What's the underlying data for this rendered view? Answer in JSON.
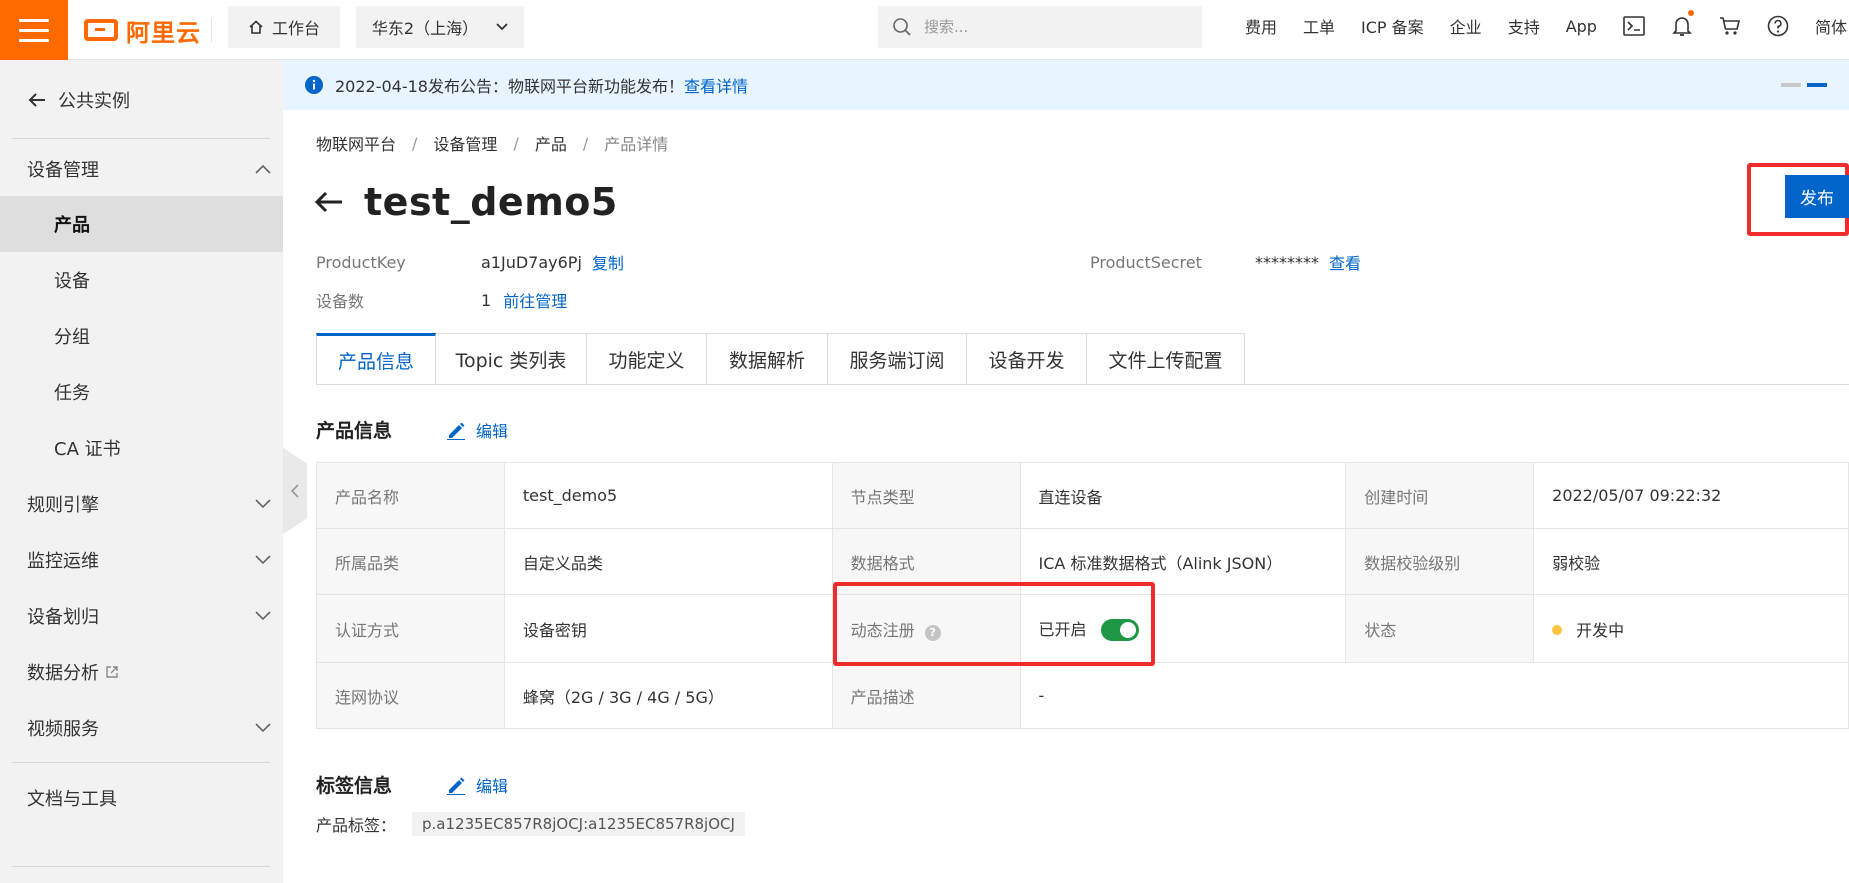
{
  "topbar": {
    "logo_text": "阿里云",
    "workbench_label": "工作台",
    "region_label": "华东2（上海）",
    "search_placeholder": "搜索...",
    "nav": [
      "费用",
      "工单",
      "ICP 备案",
      "企业",
      "支持",
      "App"
    ],
    "icons": [
      "terminal-icon",
      "bell-icon",
      "cart-icon",
      "help-icon"
    ],
    "lang_label": "简体"
  },
  "sidebar": {
    "back_label": "公共实例",
    "device_mgmt": {
      "label": "设备管理",
      "items": [
        "产品",
        "设备",
        "分组",
        "任务",
        "CA 证书"
      ],
      "active": "产品"
    },
    "groups": [
      "规则引擎",
      "监控运维",
      "设备划归",
      "数据分析",
      "视频服务"
    ],
    "docs_label": "文档与工具"
  },
  "notice": {
    "text": "2022-04-18发布公告：物联网平台新功能发布！",
    "link": "查看详情"
  },
  "breadcrumb": [
    "物联网平台",
    "设备管理",
    "产品",
    "产品详情"
  ],
  "page": {
    "title": "test_demo5",
    "publish_label": "发布"
  },
  "meta": {
    "product_key_label": "ProductKey",
    "product_key_value": "a1JuD7ay6Pj",
    "copy_label": "复制",
    "product_secret_label": "ProductSecret",
    "product_secret_value": "********",
    "view_label": "查看",
    "device_count_label": "设备数",
    "device_count_value": "1",
    "manage_label": "前往管理"
  },
  "tabs": [
    {
      "label": "产品信息",
      "active": true
    },
    {
      "label": "Topic 类列表"
    },
    {
      "label": "功能定义"
    },
    {
      "label": "数据解析"
    },
    {
      "label": "服务端订阅"
    },
    {
      "label": "设备开发"
    },
    {
      "label": "文件上传配置"
    }
  ],
  "product_info": {
    "section_title": "产品信息",
    "edit_label": "编辑",
    "rows": [
      [
        "产品名称",
        "test_demo5",
        "节点类型",
        "直连设备",
        "创建时间",
        "2022/05/07 09:22:32"
      ],
      [
        "所属品类",
        "自定义品类",
        "数据格式",
        "ICA 标准数据格式（Alink JSON）",
        "数据校验级别",
        "弱校验"
      ],
      [
        "认证方式",
        "设备密钥",
        "动态注册",
        "已开启",
        "状态",
        "开发中"
      ],
      [
        "连网协议",
        "蜂窝（2G / 3G / 4G / 5G）",
        "产品描述",
        "-",
        "",
        ""
      ]
    ],
    "status_color": "#ffc440",
    "toggle_color": "#1e9646"
  },
  "tag_info": {
    "section_title": "标签信息",
    "edit_label": "编辑",
    "tag_label": "产品标签：",
    "tag_value": "p.a1235EC857R8jOCJ:a1235EC857R8jOCJ"
  },
  "colors": {
    "brand": "#ff6a00",
    "primary": "#0064c8",
    "highlight": "#f02b2b"
  }
}
